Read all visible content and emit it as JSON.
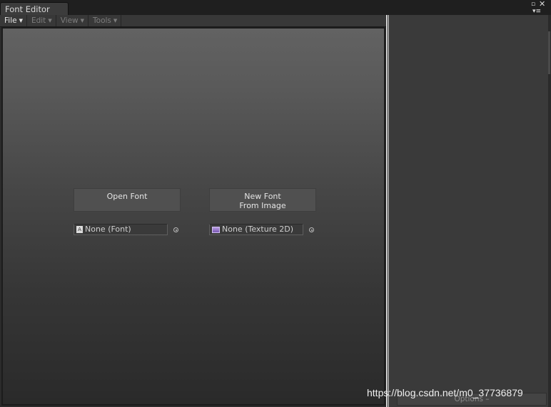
{
  "window": {
    "tab_title": "Font Editor",
    "controls": {
      "maximize_icon": "maximize-icon",
      "close_icon": "close-icon",
      "menu_icon": "panel-menu-icon"
    }
  },
  "menubar": {
    "items": [
      {
        "label": "File",
        "active": true
      },
      {
        "label": "Edit",
        "active": false
      },
      {
        "label": "View",
        "active": false
      },
      {
        "label": "Tools",
        "active": false
      }
    ]
  },
  "main": {
    "open_font_button": "Open Font",
    "new_font_button": [
      "New Font",
      "From Image"
    ],
    "font_field": {
      "value": "None (Font)",
      "icon": "font-asset-icon",
      "picker_icon": "object-picker-icon"
    },
    "texture_field": {
      "value": "None (Texture 2D)",
      "icon": "texture-asset-icon",
      "picker_icon": "object-picker-icon"
    }
  },
  "right_panel": {
    "options_button": "Options"
  },
  "watermark": "https://blog.csdn.net/m0_37736879",
  "colors": {
    "background": "#2b2b2b",
    "button": "#505050",
    "splitter": "#d8d8d8"
  }
}
